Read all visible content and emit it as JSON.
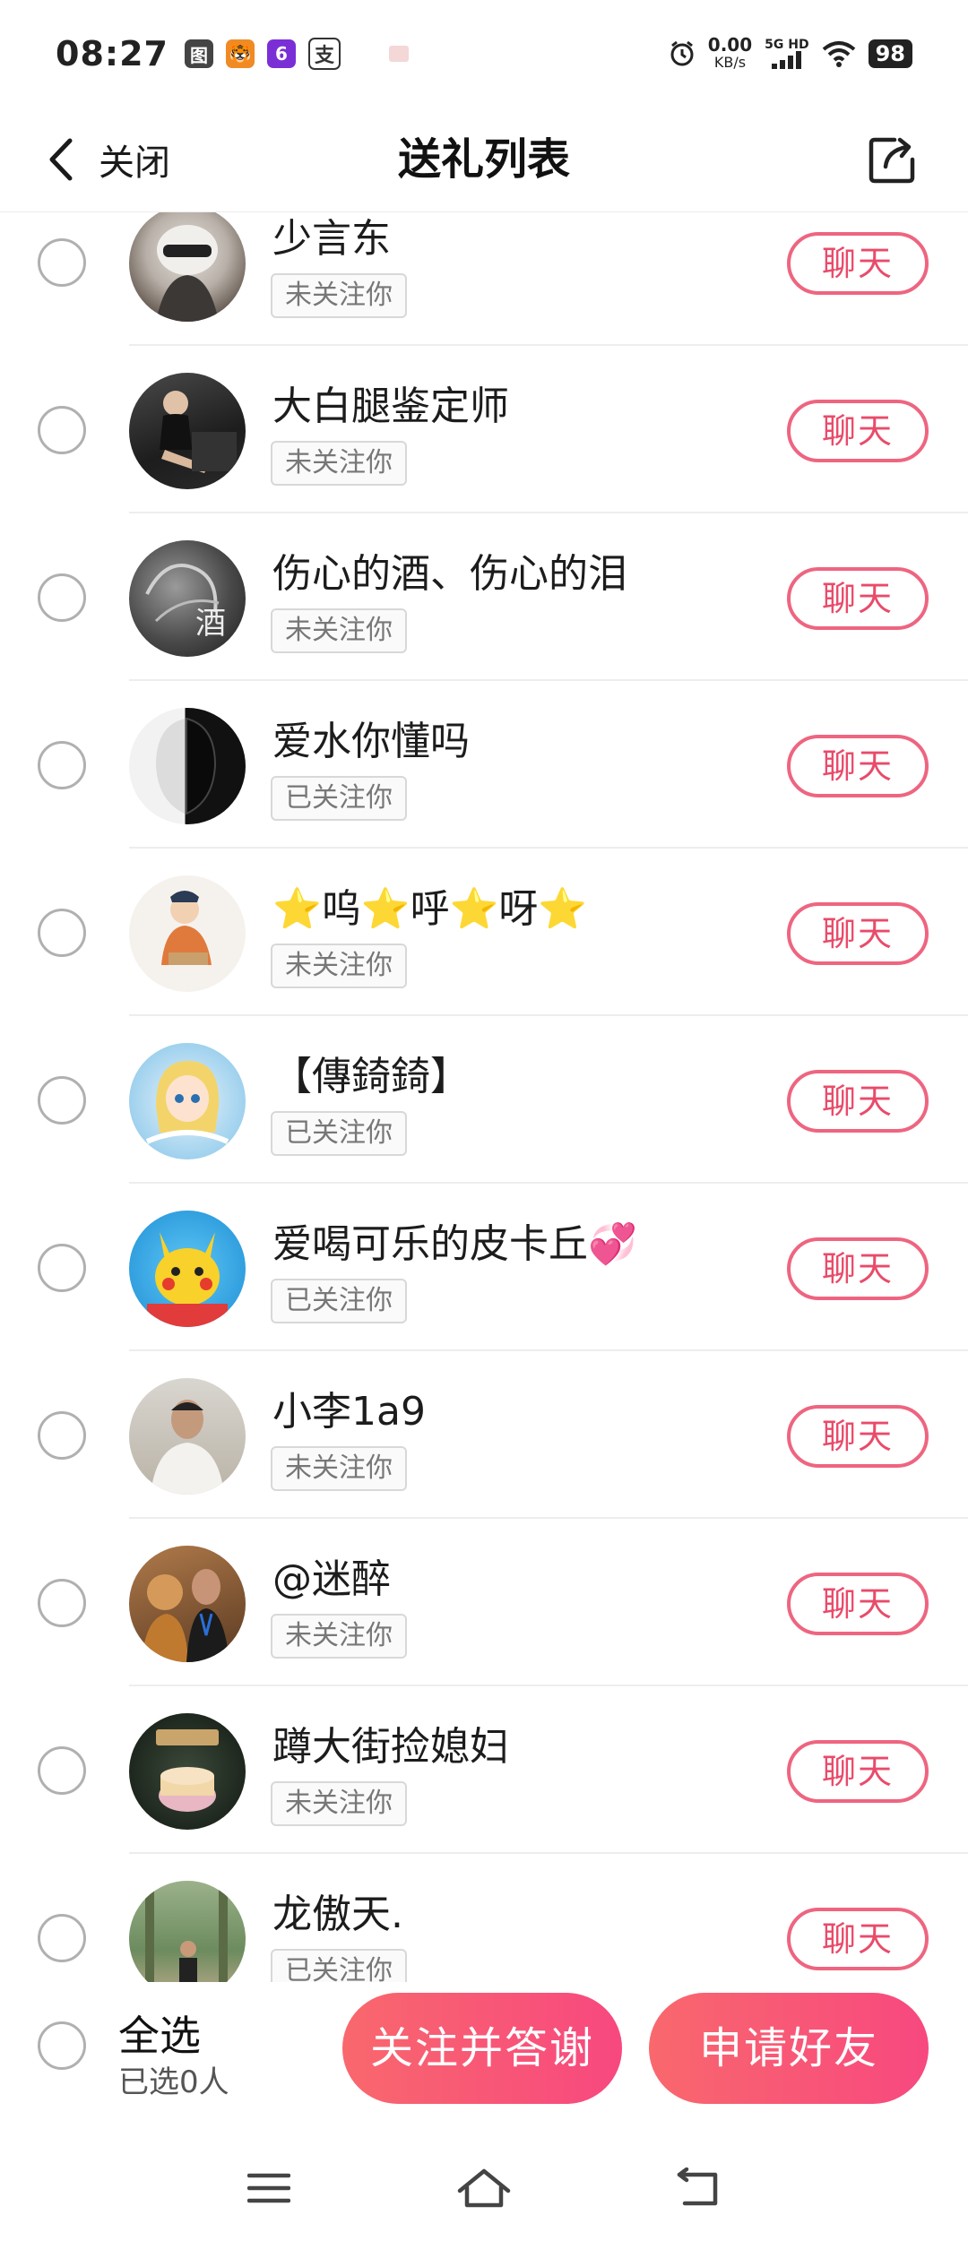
{
  "status_bar": {
    "time": "08:27",
    "apps": [
      "图",
      "6",
      "支"
    ],
    "net_speed_value": "0.00",
    "net_speed_unit": "KB/s",
    "signal_label": "5G HD",
    "battery": "98"
  },
  "header": {
    "back_label": "关闭",
    "title": "送礼列表"
  },
  "users": [
    {
      "name": "少言东",
      "follow_status": "未关注你",
      "chat_label": "聊天"
    },
    {
      "name": "大白腿鉴定师",
      "follow_status": "未关注你",
      "chat_label": "聊天"
    },
    {
      "name": "伤心的酒、伤心的泪",
      "follow_status": "未关注你",
      "chat_label": "聊天"
    },
    {
      "name": "爱水你懂吗",
      "follow_status": "已关注你",
      "chat_label": "聊天"
    },
    {
      "name": "⭐呜⭐呼⭐呀⭐",
      "follow_status": "未关注你",
      "chat_label": "聊天"
    },
    {
      "name": "【傳錡錡】",
      "follow_status": "已关注你",
      "chat_label": "聊天"
    },
    {
      "name": "爱喝可乐的皮卡丘💞",
      "follow_status": "已关注你",
      "chat_label": "聊天"
    },
    {
      "name": "小李1a9",
      "follow_status": "未关注你",
      "chat_label": "聊天"
    },
    {
      "name": "@迷醉",
      "follow_status": "未关注你",
      "chat_label": "聊天"
    },
    {
      "name": "蹲大街捡媳妇",
      "follow_status": "未关注你",
      "chat_label": "聊天"
    },
    {
      "name": "龙傲天.",
      "follow_status": "已关注你",
      "chat_label": "聊天"
    }
  ],
  "bottom_bar": {
    "select_all_label": "全选",
    "selected_count": "已选0人",
    "follow_thank_button": "关注并答谢",
    "add_friend_button": "申请好友"
  },
  "colors": {
    "accent": "#ee6580",
    "gradient_start": "#f9686d",
    "gradient_end": "#f7487f"
  },
  "icons": [
    "back-chevron-icon",
    "share-icon",
    "menu-icon",
    "home-icon",
    "back-icon",
    "alarm-icon",
    "wifi-icon",
    "signal-icon"
  ]
}
